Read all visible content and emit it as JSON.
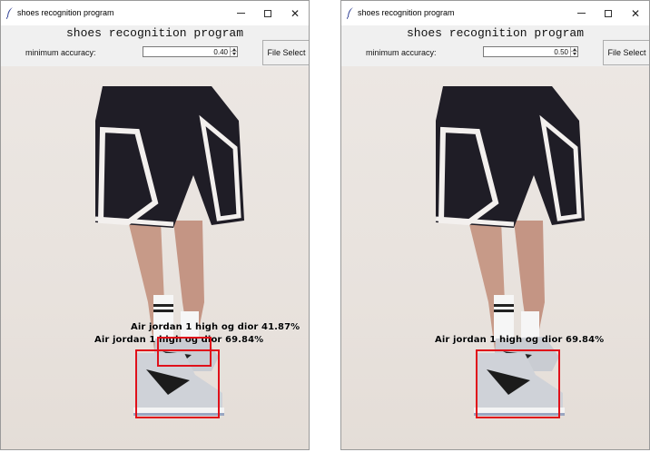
{
  "windows": [
    {
      "id": "left",
      "title": "shoes recognition program",
      "heading": "shoes recognition program",
      "accuracy_label": "minimum accuracy:",
      "accuracy_value": "0.40",
      "file_button": "File Select",
      "detections": [
        {
          "label": "Air jordan 1 high og dior 41.87%"
        },
        {
          "label": "Air jordan 1 high og dior 69.84%"
        }
      ]
    },
    {
      "id": "right",
      "title": "shoes recognition program",
      "heading": "shoes recognition program",
      "accuracy_label": "minimum accuracy:",
      "accuracy_value": "0.50",
      "file_button": "File Select",
      "detections": [
        {
          "label": "Air jordan 1 high og dior 69.84%"
        }
      ]
    }
  ],
  "icons": {
    "app": "feather-icon",
    "minimize": "minimize-icon",
    "maximize": "maximize-icon",
    "close": "close-icon"
  },
  "colors": {
    "detection_box": "#e0101a",
    "window_bg": "#f0f0f0"
  }
}
